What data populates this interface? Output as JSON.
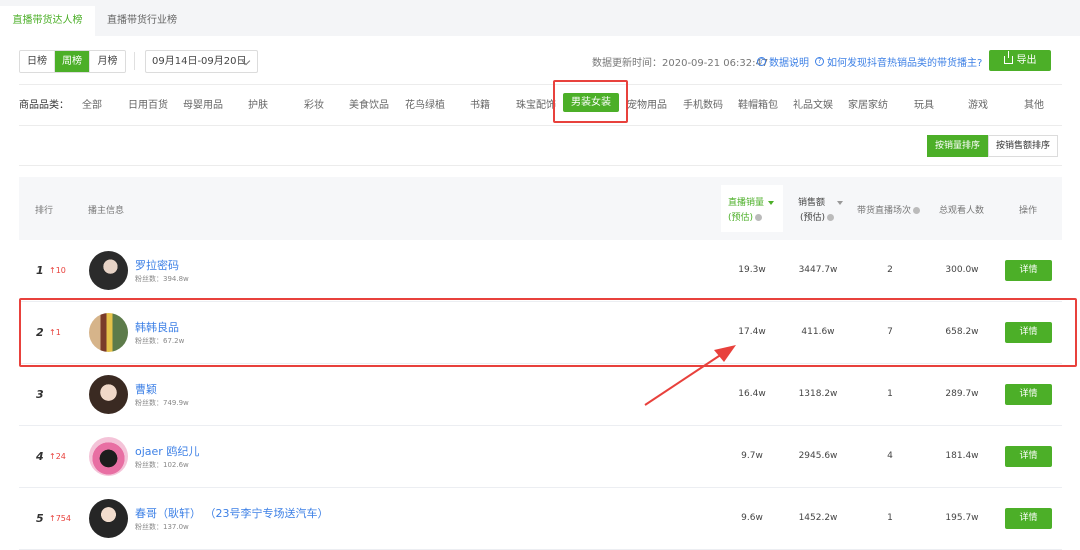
{
  "top_tabs": [
    {
      "label": "直播带货达人榜",
      "active": true
    },
    {
      "label": "直播带货行业榜",
      "active": false
    }
  ],
  "period_tabs": [
    {
      "label": "日榜",
      "active": false
    },
    {
      "label": "周榜",
      "active": true
    },
    {
      "label": "月榜",
      "active": false
    }
  ],
  "date_range": "09月14日-09月20日",
  "update_time": "数据更新时间：2020-09-21 06:32:47",
  "links": {
    "data_desc": "数据说明",
    "how_to": "如何发现抖音热销品类的带货播主?"
  },
  "export_label": "导出",
  "category": {
    "label": "商品品类：",
    "items": [
      "全部",
      "日用百货",
      "母婴用品",
      "护肤",
      "彩妆",
      "美食饮品",
      "花鸟绿植",
      "书籍",
      "珠宝配饰",
      "男装女装",
      "宠物用品",
      "手机数码",
      "鞋帽箱包",
      "礼品文娱",
      "家居家纺",
      "玩具",
      "游戏",
      "其他"
    ],
    "active": "男装女装"
  },
  "sort_buttons": [
    {
      "label": "按销量排序",
      "active": true
    },
    {
      "label": "按销售额排序",
      "active": false
    }
  ],
  "table": {
    "headers": {
      "rank": "排行",
      "info": "播主信息",
      "sales_line1": "直播销量",
      "sales_line2": "(预估)",
      "revenue_line1": "销售额",
      "revenue_line2": "(预估)",
      "sessions": "带货直播场次",
      "viewers": "总观看人数",
      "action": "操作"
    },
    "rows": [
      {
        "rank": "1",
        "change": "↑10",
        "name": "罗拉密码",
        "fans": "粉丝数：394.8w",
        "sales": "19.3w",
        "revenue": "3447.7w",
        "sessions": "2",
        "viewers": "300.0w",
        "action": "详情"
      },
      {
        "rank": "2",
        "change": "↑1",
        "name": "韩韩良品",
        "fans": "粉丝数：67.2w",
        "sales": "17.4w",
        "revenue": "411.6w",
        "sessions": "7",
        "viewers": "658.2w",
        "action": "详情"
      },
      {
        "rank": "3",
        "change": "",
        "name": "曹颖",
        "fans": "粉丝数：749.9w",
        "sales": "16.4w",
        "revenue": "1318.2w",
        "sessions": "1",
        "viewers": "289.7w",
        "action": "详情"
      },
      {
        "rank": "4",
        "change": "↑24",
        "name": "ojaer 鸥纪儿",
        "fans": "粉丝数：102.6w",
        "sales": "9.7w",
        "revenue": "2945.6w",
        "sessions": "4",
        "viewers": "181.4w",
        "action": "详情"
      },
      {
        "rank": "5",
        "change": "↑754",
        "name": "春哥（耿轩） （23号李宁专场送汽车）",
        "fans": "粉丝数：137.0w",
        "sales": "9.6w",
        "revenue": "1452.2w",
        "sessions": "1",
        "viewers": "195.7w",
        "action": "详情"
      }
    ]
  },
  "colors": {
    "accent": "#4caf28",
    "link": "#3d80e6",
    "annotation": "#e8413c"
  }
}
